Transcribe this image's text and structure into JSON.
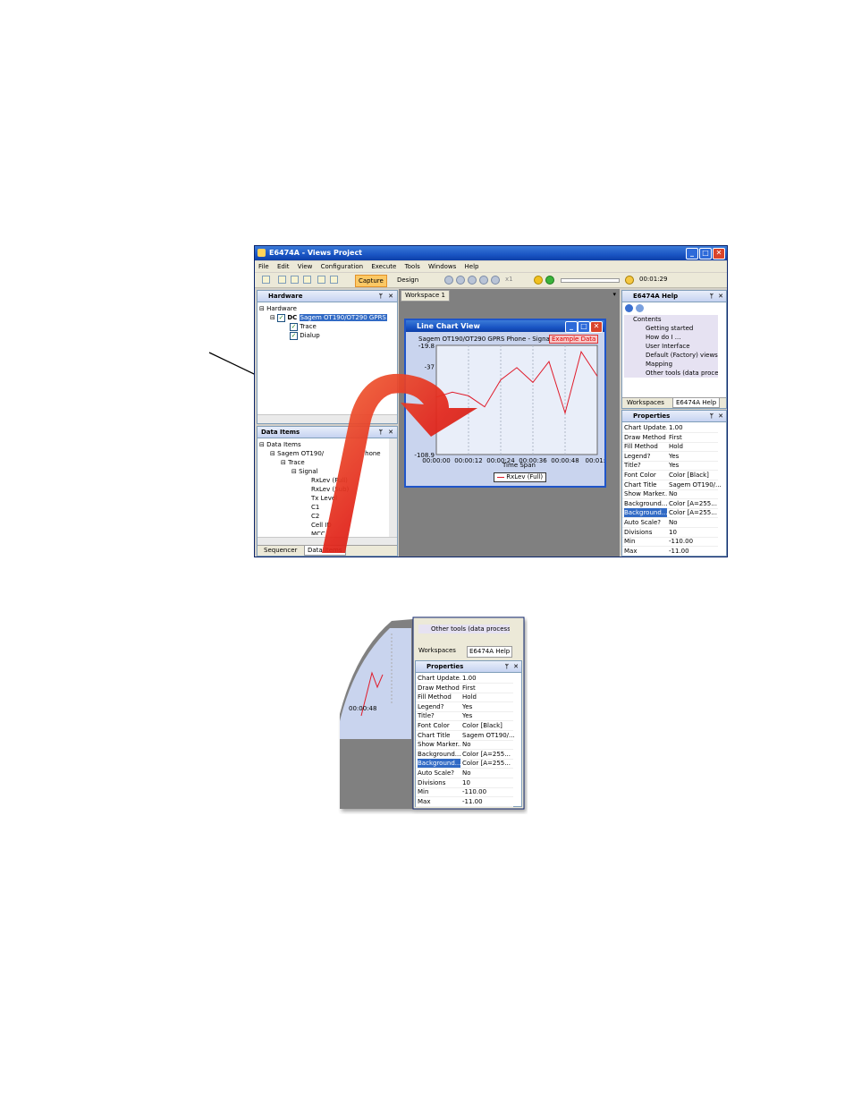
{
  "window": {
    "title": "E6474A - Views Project",
    "menu": [
      "File",
      "Edit",
      "View",
      "Configuration",
      "Execute",
      "Tools",
      "Windows",
      "Help"
    ],
    "toolbar": {
      "capture_label": "Capture",
      "design_label": "Design",
      "speed": "x1",
      "elapsed": "00:01:29"
    }
  },
  "hardware_pane": {
    "title": "Hardware",
    "tree": {
      "root": "Hardware",
      "device_prefix": "DC",
      "device": "Sagem OT190/OT290 GPRS",
      "children": [
        "Trace",
        "Dialup"
      ]
    }
  },
  "dataitems_pane": {
    "title": "Data Items",
    "tree": {
      "root": "Data Items",
      "device": "Sagem OT190/",
      "device_tail": "hone",
      "trace": "Trace",
      "signal": "Signal",
      "items": [
        "RxLev (Full)",
        "RxLev (Sub)",
        "Tx Level",
        "C1",
        "C2",
        "Cell ID",
        "MCC"
      ]
    },
    "tabs": [
      "Sequencer",
      "Data Items"
    ]
  },
  "workspace": {
    "tab": "Workspace 1"
  },
  "chart_window": {
    "title": "Line Chart View",
    "chart_title": "Sagem OT190/OT290 GPRS Phone - Signal - R",
    "badge": "Example Data",
    "y_ticks": [
      "-19.8",
      "-37",
      "-108.9"
    ],
    "xlabel": "Time Span",
    "x_ticks": [
      "00:00:00",
      "00:00:12",
      "00:00:24",
      "00:00:36",
      "00:00:48",
      "00:01:0"
    ],
    "legend": "RxLev (Full)"
  },
  "chart_data": {
    "type": "line",
    "xlabel": "Time Span",
    "x": [
      "00:00:00",
      "00:00:06",
      "00:00:12",
      "00:00:18",
      "00:00:24",
      "00:00:30",
      "00:00:36",
      "00:00:42",
      "00:00:48",
      "00:00:54",
      "00:01:00"
    ],
    "series": [
      {
        "name": "RxLev (Full)",
        "color": "#e01b2a",
        "values": [
          -62,
          -58,
          -61,
          -70,
          -48,
          -38,
          -50,
          -33,
          -75,
          -25,
          -45
        ]
      }
    ],
    "ylim": [
      -108.9,
      -19.8
    ],
    "grid": true
  },
  "help_pane": {
    "title": "E6474A Help",
    "items": [
      "Contents",
      "Getting started",
      "How do I ...",
      "User Interface",
      "Default (Factory) views",
      "Mapping",
      "Other tools (data process"
    ],
    "tabs": [
      "Workspaces",
      "E6474A Help"
    ]
  },
  "properties_pane": {
    "title": "Properties",
    "rows": [
      {
        "k": "Chart Update...",
        "v": "1.00"
      },
      {
        "k": "Draw Method",
        "v": "First"
      },
      {
        "k": "Fill Method",
        "v": "Hold"
      },
      {
        "k": "Legend?",
        "v": "Yes"
      },
      {
        "k": "Title?",
        "v": "Yes"
      },
      {
        "k": "Font Color",
        "v": "Color [Black]"
      },
      {
        "k": "Chart Title",
        "v": "Sagem OT190/..."
      },
      {
        "k": "Show Marker...",
        "v": "No"
      },
      {
        "k": "Background...",
        "v": "Color [A=255..."
      },
      {
        "k": "Background...",
        "v": "Color [A=255..."
      },
      {
        "k": "Auto Scale?",
        "v": "No"
      },
      {
        "k": "Divisions",
        "v": "10"
      },
      {
        "k": "Min",
        "v": "-110.00"
      },
      {
        "k": "Max",
        "v": "-11.00"
      }
    ]
  },
  "zoom_inset": {
    "help_item": "Other tools (data processi",
    "tabs": [
      "Workspaces",
      "E6474A Help"
    ],
    "x_tick": "00:00:48",
    "props_title": "Properties",
    "rows": [
      {
        "k": "Chart Update...",
        "v": "1.00"
      },
      {
        "k": "Draw Method",
        "v": "First"
      },
      {
        "k": "Fill Method",
        "v": "Hold"
      },
      {
        "k": "Legend?",
        "v": "Yes"
      },
      {
        "k": "Title?",
        "v": "Yes"
      },
      {
        "k": "Font Color",
        "v": "Color [Black]"
      },
      {
        "k": "Chart Title",
        "v": "Sagem OT190/..."
      },
      {
        "k": "Show Marker...",
        "v": "No"
      },
      {
        "k": "Background...",
        "v": "Color [A=255..."
      },
      {
        "k": "Background...",
        "v": "Color [A=255..."
      },
      {
        "k": "Auto Scale?",
        "v": "No"
      },
      {
        "k": "Divisions",
        "v": "10"
      },
      {
        "k": "Min",
        "v": "-110.00"
      },
      {
        "k": "Max",
        "v": "-11.00"
      }
    ]
  }
}
